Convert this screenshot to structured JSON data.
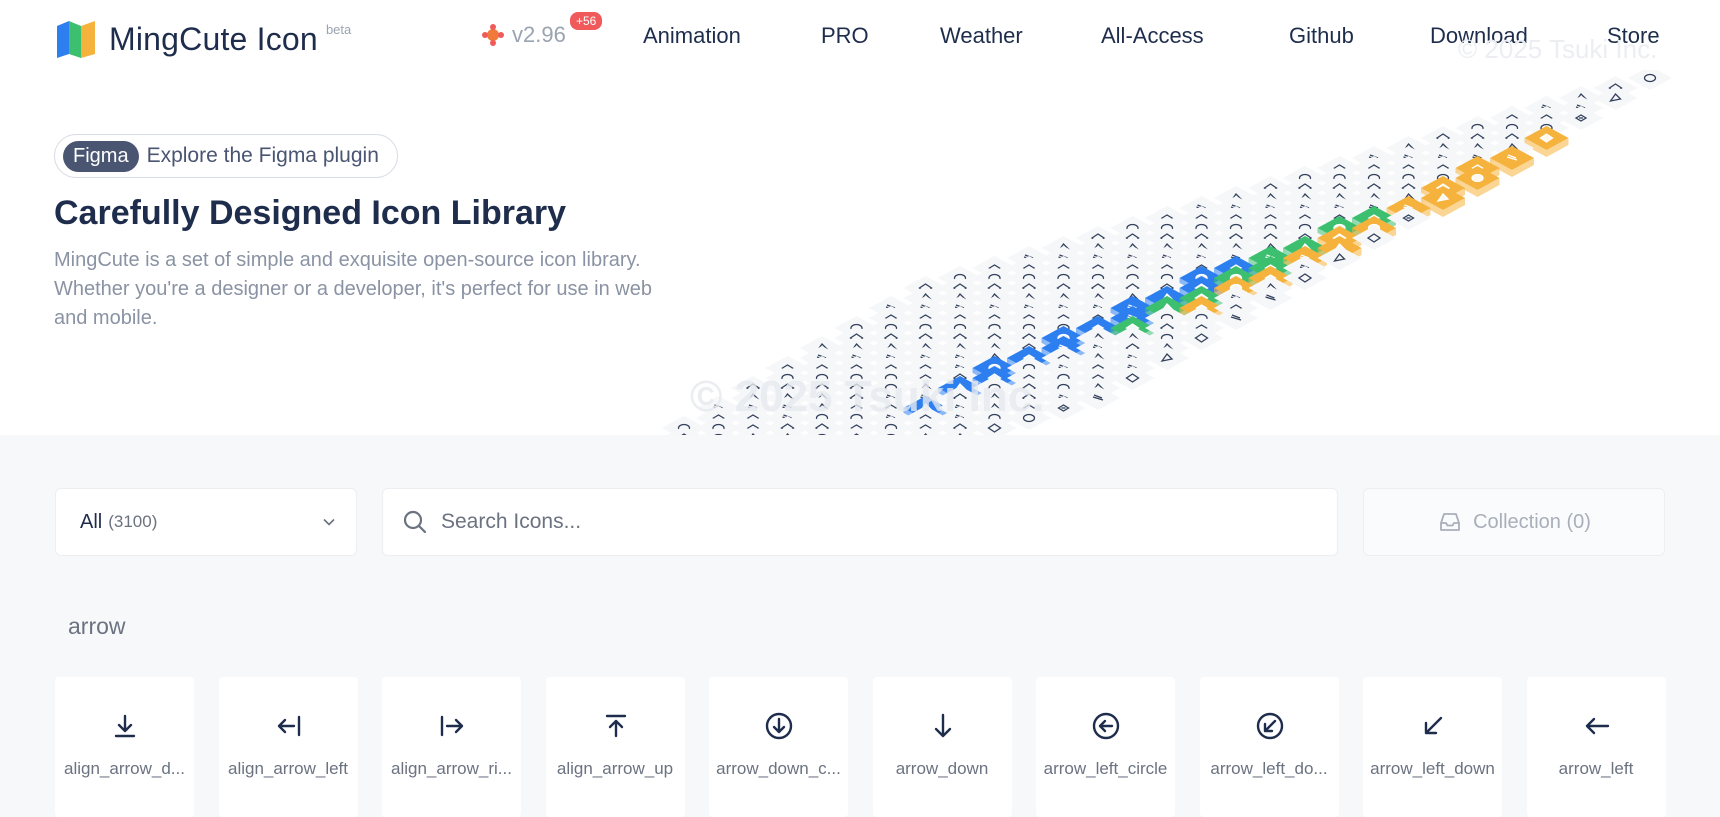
{
  "header": {
    "logo_text": "MingCute Icon",
    "beta": "beta",
    "version": "v2.96",
    "version_badge": "+56",
    "nav": [
      {
        "label": "Animation"
      },
      {
        "label": "PRO"
      },
      {
        "label": "Weather"
      },
      {
        "label": "All-Access"
      },
      {
        "label": "Github"
      },
      {
        "label": "Download"
      },
      {
        "label": "Store"
      }
    ],
    "watermark": "© 2025 Tsuki Inc."
  },
  "hero": {
    "figma_tag": "Figma",
    "figma_text": "Explore the Figma plugin",
    "title": "Carefully Designed Icon Library",
    "description": "MingCute is a set of simple and exquisite open-source icon library. Whether you're a designer or a developer, it's perfect for use in web and mobile.",
    "watermark": "© 2025 Tsuki Inc.",
    "illustration_colors": {
      "blue": "#2d7ff0",
      "green": "#3cc06f",
      "orange": "#f5b23c",
      "tile": "#f6f7f9"
    }
  },
  "toolbar": {
    "category_label": "All",
    "category_count": "(3100)",
    "search_placeholder": "Search Icons...",
    "collection_label": "Collection (0)"
  },
  "section": {
    "label": "arrow"
  },
  "icons": [
    {
      "name": "align_arrow_d...",
      "icon": "align-arrow-down-icon"
    },
    {
      "name": "align_arrow_left",
      "icon": "align-arrow-left-icon"
    },
    {
      "name": "align_arrow_ri...",
      "icon": "align-arrow-right-icon"
    },
    {
      "name": "align_arrow_up",
      "icon": "align-arrow-up-icon"
    },
    {
      "name": "arrow_down_c...",
      "icon": "arrow-down-circle-icon"
    },
    {
      "name": "arrow_down",
      "icon": "arrow-down-icon"
    },
    {
      "name": "arrow_left_circle",
      "icon": "arrow-left-circle-icon"
    },
    {
      "name": "arrow_left_do...",
      "icon": "arrow-left-down-circle-icon"
    },
    {
      "name": "arrow_left_down",
      "icon": "arrow-left-down-icon"
    },
    {
      "name": "arrow_left",
      "icon": "arrow-left-icon"
    }
  ]
}
